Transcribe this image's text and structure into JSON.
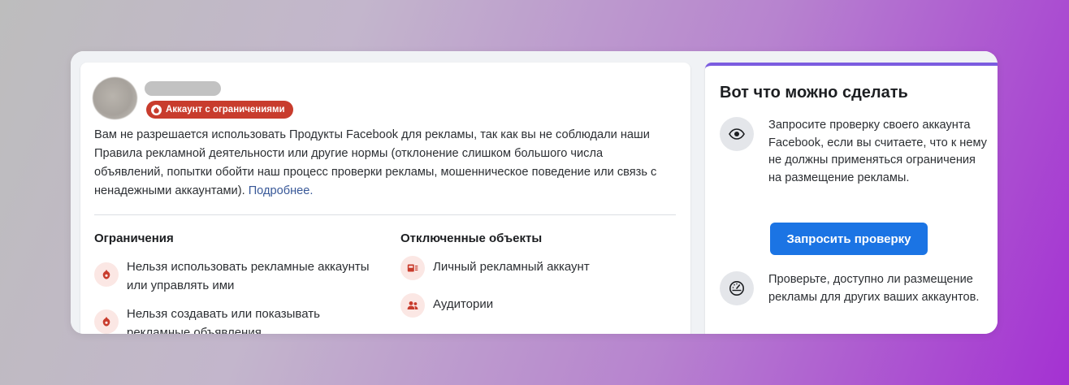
{
  "account": {
    "badge_label": "Аккаунт с ограничениями"
  },
  "description": {
    "text": "Вам не разрешается использовать Продукты Facebook для рекламы, так как вы не соблюдали наши Правила рекламной деятельности или другие нормы (отклонение слишком большого числа объявлений, попытки обойти наш процесс проверки рекламы, мошенническое поведение или связь с ненадежными аккаунтами).",
    "link_label": "Подробнее."
  },
  "restrictions": {
    "title": "Ограничения",
    "items": [
      {
        "label": "Нельзя использовать рекламные аккаунты или управлять ими",
        "icon": "restriction-icon"
      },
      {
        "label": "Нельзя создавать или показывать рекламные объявления",
        "icon": "restriction-icon"
      }
    ]
  },
  "disabled": {
    "title": "Отключенные объекты",
    "items": [
      {
        "label": "Личный рекламный аккаунт",
        "icon": "ad-account-icon"
      },
      {
        "label": "Аудитории",
        "icon": "audience-icon"
      }
    ]
  },
  "actions": {
    "title": "Вот что можно сделать",
    "review": {
      "text": "Запросите проверку своего аккаунта Facebook, если вы считаете, что к нему не должны применяться ограничения на размещение рекламы.",
      "icon": "eye-icon",
      "button_label": "Запросить проверку"
    },
    "check": {
      "text": "Проверьте, доступно ли размещение рекламы для других ваших аккаунтов.",
      "icon": "gauge-icon"
    }
  },
  "colors": {
    "badge": "#c83c2d",
    "button": "#1b74e4",
    "link": "#385898",
    "accent_top": "#7b5ce0"
  }
}
